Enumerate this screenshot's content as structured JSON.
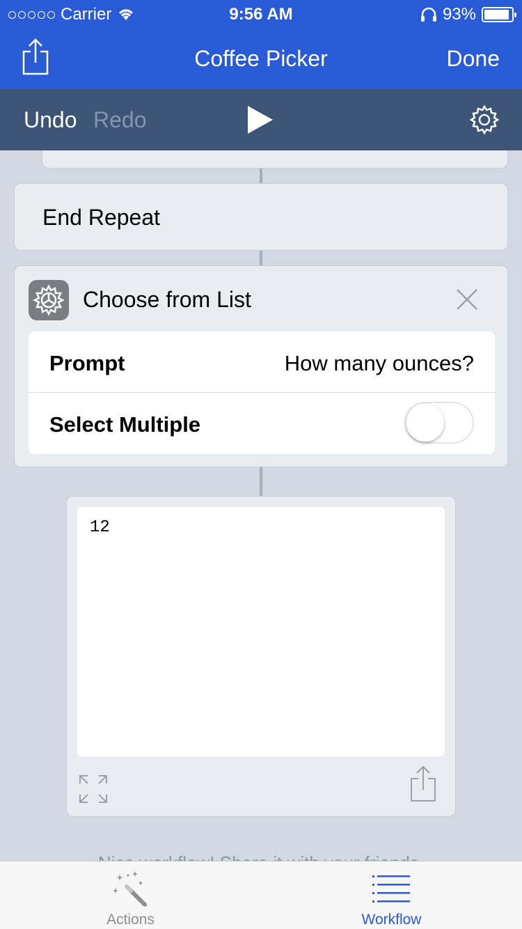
{
  "status_bar": {
    "carrier": "Carrier",
    "time": "9:56 AM",
    "battery": "93%",
    "battery_level": 0.93
  },
  "nav": {
    "title": "Coffee Picker",
    "done_label": "Done",
    "share_icon": "share-icon"
  },
  "toolbar": {
    "undo_label": "Undo",
    "redo_label": "Redo",
    "play_icon": "play-icon",
    "settings_icon": "gear-icon"
  },
  "actions": {
    "end_repeat_label": "End Repeat",
    "choose_from_list": {
      "title": "Choose from List",
      "prompt_label": "Prompt",
      "prompt_value": "How many ounces?",
      "select_multiple_label": "Select Multiple",
      "select_multiple_on": false
    },
    "result": {
      "text": "12"
    }
  },
  "footer_note": "Nice workflow! Share it with your friends.",
  "tabs": [
    {
      "label": "Actions",
      "icon": "magic-wand-icon",
      "selected": false
    },
    {
      "label": "Workflow",
      "icon": "list-icon",
      "selected": true
    }
  ]
}
